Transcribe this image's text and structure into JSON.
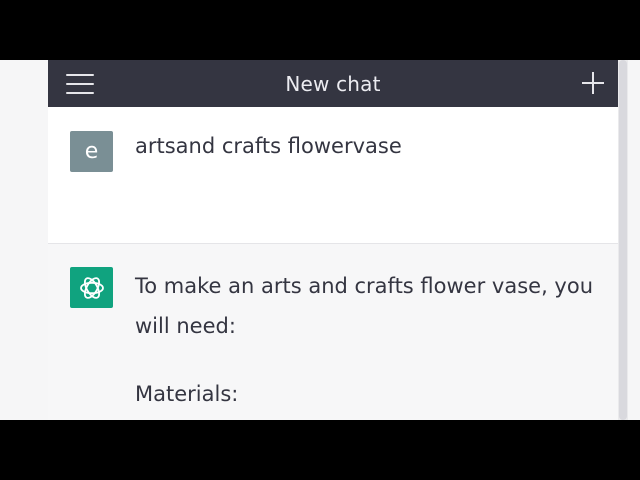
{
  "header": {
    "title": "New chat",
    "menu_icon": "hamburger-menu-icon",
    "new_chat_icon": "plus-icon"
  },
  "conversation": {
    "user_message": {
      "avatar_letter": "e",
      "avatar_color": "#7a8f95",
      "text": "artsand crafts flowervase"
    },
    "assistant_message": {
      "avatar_icon": "openai-logo-icon",
      "avatar_color": "#10a37f",
      "paragraph_1": "To make an arts and crafts flower vase, you will need:",
      "paragraph_2": "Materials:"
    }
  },
  "colors": {
    "header_bg": "#343541",
    "user_bg": "#ffffff",
    "assistant_bg": "#f7f7f8",
    "text": "#343541"
  }
}
